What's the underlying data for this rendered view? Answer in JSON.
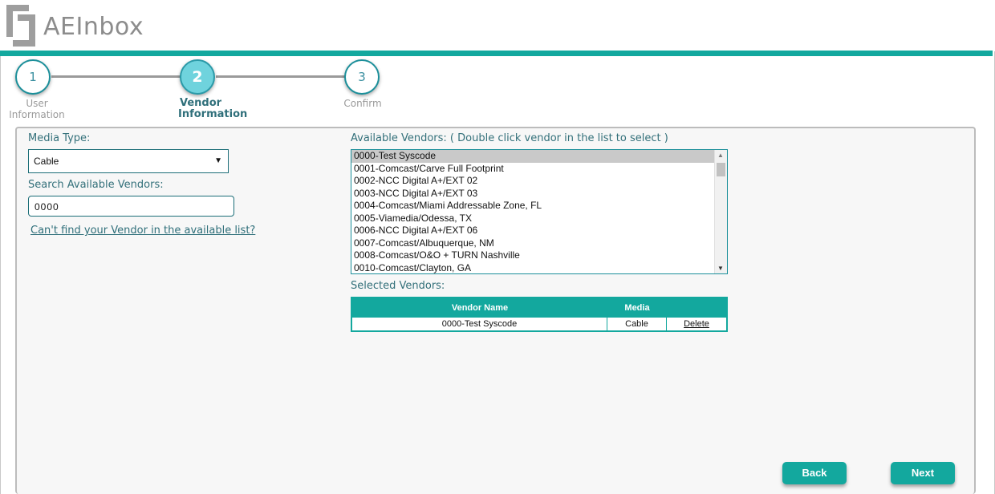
{
  "app": {
    "logo_text": "AEInbox",
    "accent_color": "#13a89e"
  },
  "stepper": {
    "steps": [
      {
        "number": "1",
        "label_line1": "User",
        "label_line2": "Information",
        "state": "completed"
      },
      {
        "number": "2",
        "label_line1": "Vendor",
        "label_line2": "Information",
        "state": "active"
      },
      {
        "number": "3",
        "label_line1": "Confirm",
        "label_line2": "",
        "state": "pending"
      }
    ]
  },
  "form": {
    "media_type_label": "Media Type:",
    "media_type_value": "Cable",
    "search_label": "Search Available Vendors:",
    "search_value": "0000",
    "cant_find_link": "Can't find your Vendor in the available list?"
  },
  "available_vendors": {
    "label": "Available Vendors: ( Double click vendor in the list to select )",
    "selected_index": 0,
    "items": [
      "0000-Test Syscode",
      "0001-Comcast/Carve Full Footprint",
      "0002-NCC Digital A+/EXT 02",
      "0003-NCC Digital A+/EXT 03",
      "0004-Comcast/Miami Addressable Zone, FL",
      "0005-Viamedia/Odessa, TX",
      "0006-NCC Digital A+/EXT 06",
      "0007-Comcast/Albuquerque, NM",
      "0008-Comcast/O&O + TURN Nashville",
      "0010-Comcast/Clayton, GA"
    ]
  },
  "selected_vendors": {
    "label": "Selected Vendors:",
    "headers": [
      "Vendor Name",
      "Media"
    ],
    "rows": [
      {
        "vendor_name": "0000-Test Syscode",
        "media": "Cable",
        "action": "Delete"
      }
    ]
  },
  "buttons": {
    "back": "Back",
    "next": "Next"
  }
}
